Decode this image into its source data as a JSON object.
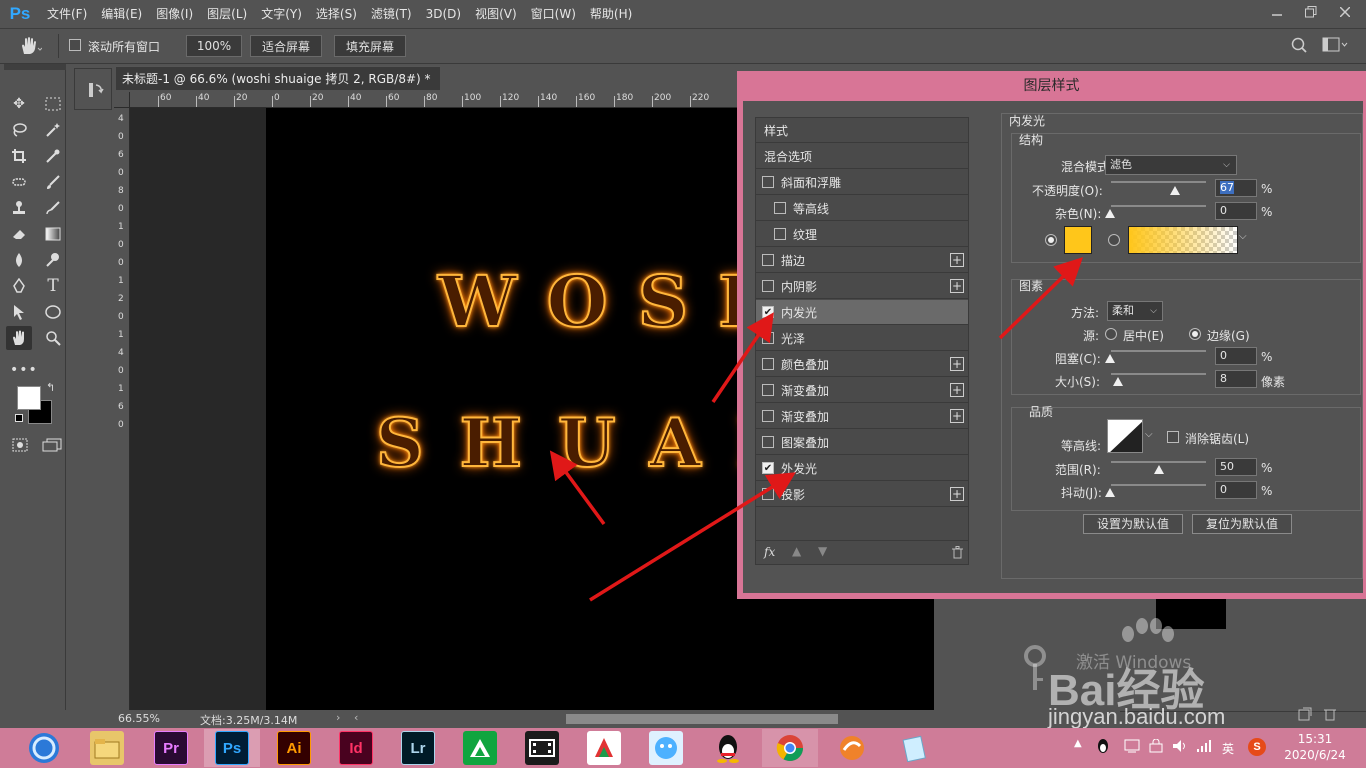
{
  "app": {
    "logo": "Ps"
  },
  "menu": [
    "文件(F)",
    "编辑(E)",
    "图像(I)",
    "图层(L)",
    "文字(Y)",
    "选择(S)",
    "滤镜(T)",
    "3D(D)",
    "视图(V)",
    "窗口(W)",
    "帮助(H)"
  ],
  "options": {
    "scroll_all_label": "滚动所有窗口",
    "zoom_value": "100%",
    "fit_screen": "适合屏幕",
    "fill_screen": "填充屏幕"
  },
  "document": {
    "tab_title": "未标题-1 @ 66.6% (woshi shuaige 拷贝 2, RGB/8#) *",
    "ruler_h_ticks": [
      "60",
      "40",
      "20",
      "0",
      "20",
      "40",
      "60",
      "80",
      "100",
      "120",
      "140",
      "160",
      "180",
      "200",
      "220"
    ],
    "ruler_v_ticks": [
      "4",
      "0",
      "6",
      "0",
      "8",
      "0",
      "1",
      "0",
      "0",
      "1",
      "2",
      "0",
      "1",
      "4",
      "0",
      "1",
      "6",
      "0"
    ],
    "text_line1": "WOSH",
    "text_line2": "SHUAI",
    "status_zoom": "66.55%",
    "status_doc": "文档:3.25M/3.14M"
  },
  "dialog": {
    "title": "图层样式",
    "styles_header": "样式",
    "blend_options": "混合选项",
    "style_items": [
      {
        "label": "斜面和浮雕",
        "checked": false,
        "plus": false,
        "indent": false
      },
      {
        "label": "等高线",
        "checked": false,
        "plus": false,
        "indent": true
      },
      {
        "label": "纹理",
        "checked": false,
        "plus": false,
        "indent": true
      },
      {
        "label": "描边",
        "checked": false,
        "plus": true,
        "indent": false
      },
      {
        "label": "内阴影",
        "checked": false,
        "plus": true,
        "indent": false
      },
      {
        "label": "内发光",
        "checked": true,
        "plus": false,
        "indent": false,
        "selected": true
      },
      {
        "label": "光泽",
        "checked": false,
        "plus": false,
        "indent": false
      },
      {
        "label": "颜色叠加",
        "checked": false,
        "plus": true,
        "indent": false
      },
      {
        "label": "渐变叠加",
        "checked": false,
        "plus": true,
        "indent": false
      },
      {
        "label": "渐变叠加",
        "checked": false,
        "plus": true,
        "indent": false
      },
      {
        "label": "图案叠加",
        "checked": false,
        "plus": false,
        "indent": false
      },
      {
        "label": "外发光",
        "checked": true,
        "plus": false,
        "indent": false
      },
      {
        "label": "投影",
        "checked": false,
        "plus": true,
        "indent": false
      }
    ],
    "fx_label": "fx",
    "section_title": "内发光",
    "structure": {
      "title": "结构",
      "blend_mode_label": "混合模式:",
      "blend_mode_value": "滤色",
      "opacity_label": "不透明度(O):",
      "opacity_value": "67",
      "opacity_level": 0.67,
      "noise_label": "杂色(N):",
      "noise_value": "0",
      "percent": "%",
      "color": "#ffc61a"
    },
    "elements": {
      "title": "图素",
      "method_label": "方法:",
      "method_value": "柔和",
      "source_label": "源:",
      "source_center": "居中(E)",
      "source_edge": "边缘(G)",
      "choke_label": "阻塞(C):",
      "choke_value": "0",
      "size_label": "大小(S):",
      "size_value": "8",
      "size_unit": "像素"
    },
    "quality": {
      "title": "品质",
      "contour_label": "等高线:",
      "antialias_label": "消除锯齿(L)",
      "range_label": "范围(R):",
      "range_value": "50",
      "jitter_label": "抖动(J):",
      "jitter_value": "0"
    },
    "set_default": "设置为默认值",
    "reset_default": "复位为默认值"
  },
  "watermark": {
    "activate": "激活 Windows",
    "baidu": "Bai经验",
    "url": "jingyan.baidu.com"
  },
  "taskbar": {
    "apps": [
      "Pr",
      "Ps",
      "Ai",
      "Id",
      "Lr"
    ],
    "time": "15:31",
    "date": "2020/6/24",
    "ime": "英"
  }
}
